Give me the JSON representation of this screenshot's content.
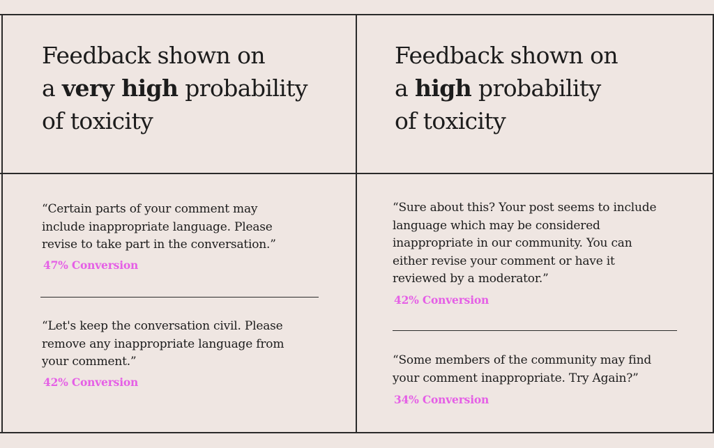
{
  "left_column": {
    "heading": {
      "line1": "Feedback shown on",
      "line2_prefix": "a ",
      "line2_bold": "very high",
      "line2_suffix": " probability",
      "line3": "of toxicity"
    },
    "items": [
      {
        "quote_lines": [
          "“Certain parts of your comment may",
          "include inappropriate language. Please",
          "revise to take part in the conversation.”"
        ],
        "conversion": "47% Conversion"
      },
      {
        "quote_lines": [
          "“Let's keep the conversation civil. Please",
          "remove any inappropriate language from",
          "your comment.”"
        ],
        "conversion": "42% Conversion"
      }
    ]
  },
  "right_column": {
    "heading": {
      "line1": "Feedback shown on",
      "line2_prefix": "a ",
      "line2_bold": "high",
      "line2_suffix": " probability",
      "line3": "of toxicity"
    },
    "items": [
      {
        "quote_lines": [
          "“Sure about this? Your post seems to include",
          "language which may be considered",
          "inappropriate in our community. You can",
          "either revise your comment or have it",
          "reviewed by a moderator.”"
        ],
        "conversion": "42% Conversion"
      },
      {
        "quote_lines": [
          "“Some members of the community may find",
          "your comment inappropriate. Try Again?”"
        ],
        "conversion": "34% Conversion"
      }
    ]
  },
  "colors": {
    "background": "#efe6e2",
    "text": "#1c1c1c",
    "accent": "#e55fe6",
    "rule": "#2a2a2a"
  }
}
